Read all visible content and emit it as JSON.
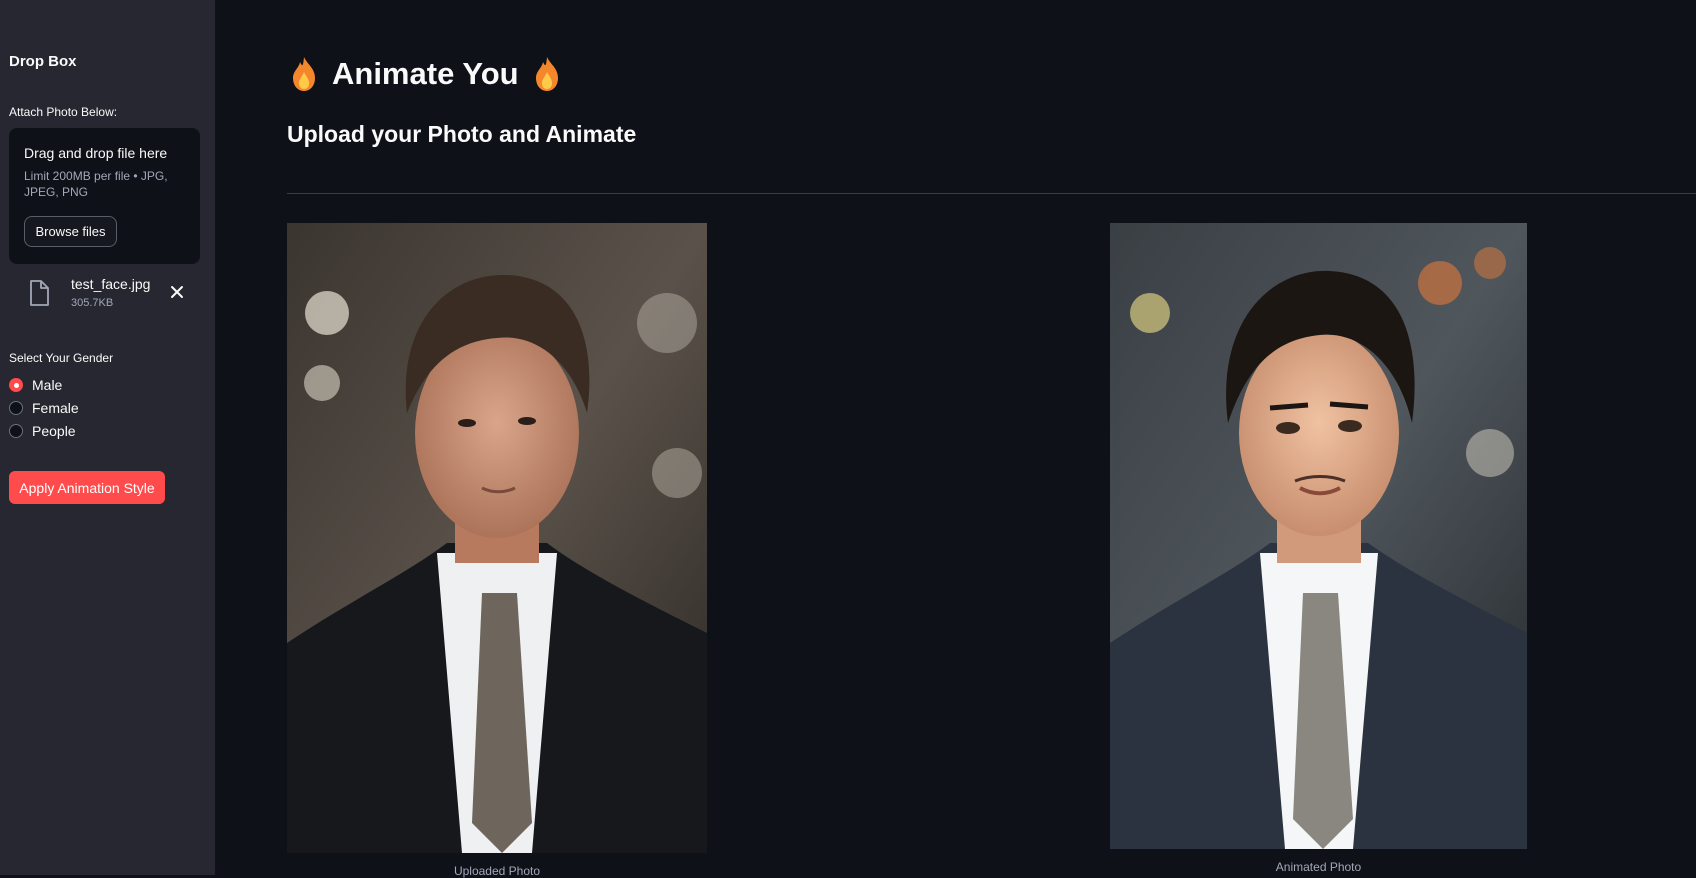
{
  "sidebar": {
    "title": "Drop Box",
    "attach_label": "Attach Photo Below:",
    "dropzone": {
      "title": "Drag and drop file here",
      "limit": "Limit 200MB per file • JPG, JPEG, PNG",
      "browse_label": "Browse files"
    },
    "file": {
      "name": "test_face.jpg",
      "size": "305.7KB"
    },
    "gender_label": "Select Your Gender",
    "gender_options": [
      {
        "label": "Male",
        "selected": true
      },
      {
        "label": "Female",
        "selected": false
      },
      {
        "label": "People",
        "selected": false
      }
    ],
    "apply_label": "Apply Animation Style"
  },
  "main": {
    "title": "Animate You",
    "subtitle": "Upload your Photo and Animate",
    "uploaded_caption": "Uploaded Photo",
    "animated_caption": "Animated Photo"
  },
  "colors": {
    "background": "#0e1117",
    "sidebar": "#262730",
    "accent": "#ff4b4b"
  },
  "icons": {
    "file": "file-icon",
    "close": "close-icon",
    "flame": "fire-icon"
  }
}
